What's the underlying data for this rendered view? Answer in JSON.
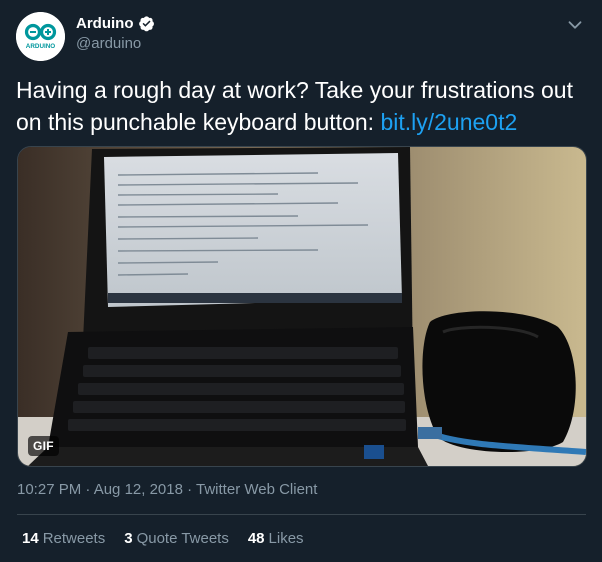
{
  "account": {
    "display_name": "Arduino",
    "handle": "@arduino",
    "avatar_text": "ARDUINO"
  },
  "tweet": {
    "text": "Having a rough day at work? Take your frustrations out on this punchable keyboard button: ",
    "link": "bit.ly/2une0t2",
    "media_badge": "GIF",
    "timestamp": "10:27 PM · Aug 12, 2018 · Twitter Web Client"
  },
  "stats": {
    "retweets_count": "14",
    "retweets_label": "Retweets",
    "quote_tweets_count": "3",
    "quote_tweets_label": "Quote Tweets",
    "likes_count": "48",
    "likes_label": "Likes"
  },
  "colors": {
    "background": "#15202b",
    "link": "#1da1f2",
    "muted": "#8899a6",
    "border": "#38444d",
    "arduino_teal": "#00979d"
  },
  "icons": {
    "verified": "verified-badge-icon",
    "caret": "chevron-down-icon"
  }
}
